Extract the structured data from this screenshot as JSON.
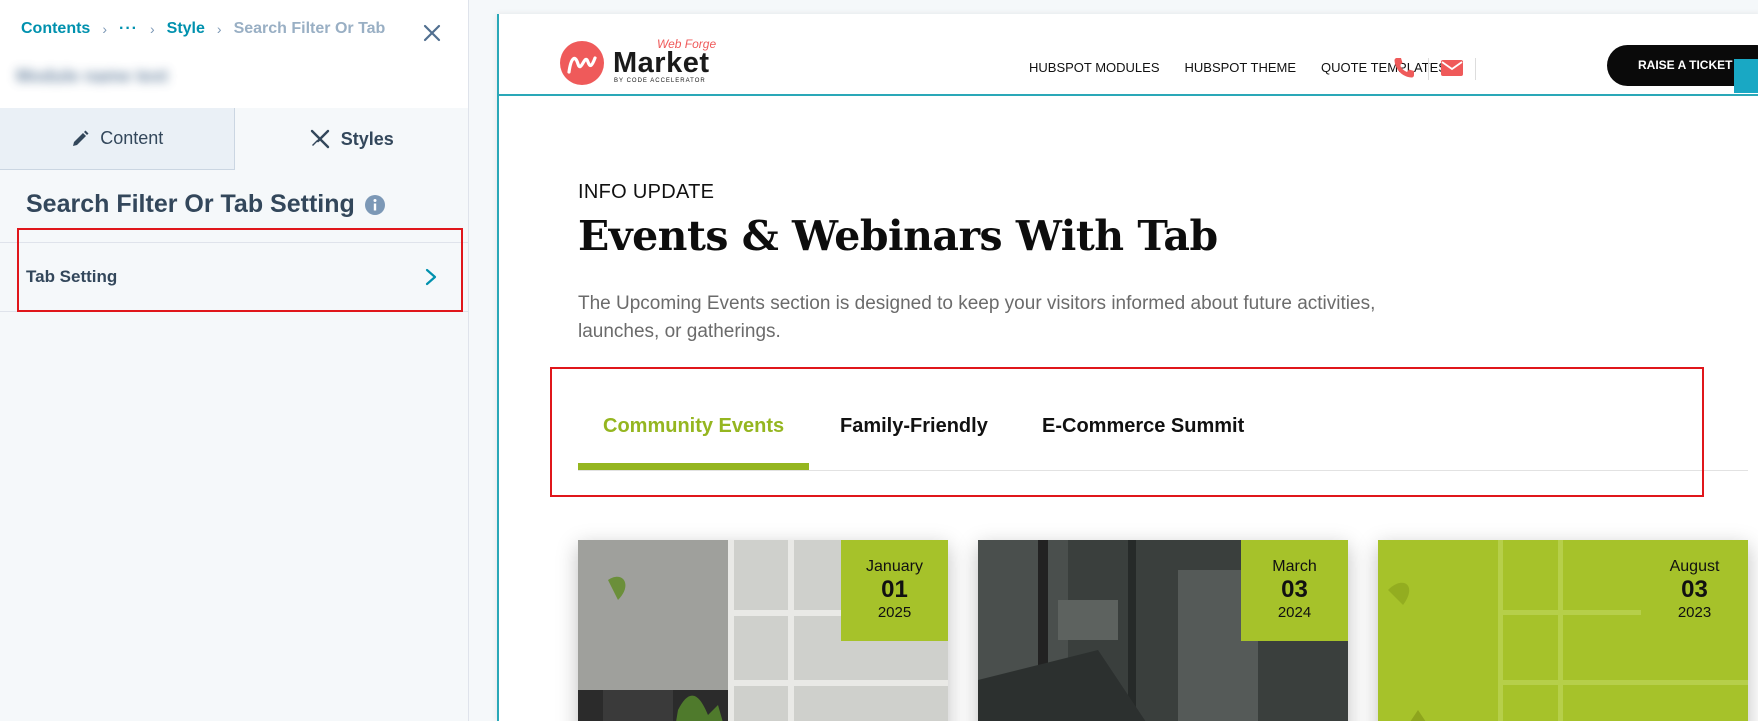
{
  "editor": {
    "breadcrumb": {
      "contents": "Contents",
      "more": "···",
      "style": "Style",
      "current": "Search Filter Or Tab"
    },
    "module_name": "Module name text",
    "tabs": {
      "content": "Content",
      "styles": "Styles"
    },
    "section_title": "Search Filter Or Tab Setting",
    "setting_row": "Tab Setting"
  },
  "site": {
    "logo": {
      "brand": "Market",
      "tag": "Web Forge",
      "sub": "BY CODE ACCELERATOR"
    },
    "nav": [
      "HUBSPOT MODULES",
      "HUBSPOT THEME",
      "QUOTE TEMPLATES"
    ],
    "cta": "RAISE A TICKET",
    "accent_colors": {
      "coral": "#ef5a5a",
      "lime": "#95b620",
      "teal": "#2aa8b8"
    }
  },
  "page": {
    "eyebrow": "INFO UPDATE",
    "headline": "Events & Webinars With Tab",
    "description": "The Upcoming Events section is designed to keep your visitors informed about future activities, launches, or gatherings.",
    "tabs": [
      {
        "label": "Community Events",
        "active": true
      },
      {
        "label": "Family-Friendly",
        "active": false
      },
      {
        "label": "E-Commerce Summit",
        "active": false
      }
    ],
    "cards": [
      {
        "month": "January",
        "day": "01",
        "year": "2025"
      },
      {
        "month": "March",
        "day": "03",
        "year": "2024"
      },
      {
        "month": "August",
        "day": "03",
        "year": "2023"
      }
    ]
  }
}
